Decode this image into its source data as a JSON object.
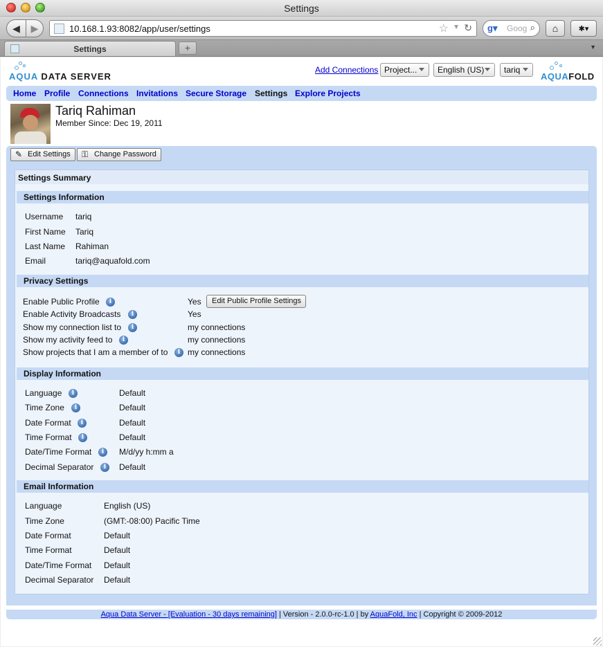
{
  "window": {
    "title": "Settings"
  },
  "browser": {
    "url": "10.168.1.93:8082/app/user/settings",
    "search_placeholder": "Google",
    "tab_label": "Settings",
    "new_tab_label": "+"
  },
  "header": {
    "logo_left_aqua": "AQUA",
    "logo_left_rest": " DATA SERVER",
    "logo_right_aqua": "AQUA",
    "logo_right_rest": "FOLD",
    "add_connections": "Add Connections",
    "project_select": "Project...",
    "language_select": "English (US)",
    "user_select": "tariq"
  },
  "menu": {
    "items": [
      {
        "label": "Home"
      },
      {
        "label": "Profile"
      },
      {
        "label": "Connections"
      },
      {
        "label": "Invitations"
      },
      {
        "label": "Secure Storage"
      },
      {
        "label": "Settings"
      },
      {
        "label": "Explore Projects"
      }
    ]
  },
  "user": {
    "name": "Tariq Rahiman",
    "member_since": "Member Since: Dec 19, 2011"
  },
  "toolbar": {
    "edit_settings": "Edit Settings",
    "change_password": "Change Password"
  },
  "summary": {
    "title": "Settings Summary",
    "settings_info": {
      "header": "Settings Information",
      "rows": [
        {
          "label": "Username",
          "value": "tariq"
        },
        {
          "label": "First Name",
          "value": "Tariq"
        },
        {
          "label": "Last Name",
          "value": "Rahiman"
        },
        {
          "label": "Email",
          "value": "tariq@aquafold.com"
        }
      ]
    },
    "privacy": {
      "header": "Privacy Settings",
      "edit_button": "Edit Public Profile Settings",
      "rows": [
        {
          "label": "Enable Public Profile",
          "value": "Yes"
        },
        {
          "label": "Enable Activity Broadcasts",
          "value": "Yes"
        },
        {
          "label": "Show my connection list to",
          "value": "my connections"
        },
        {
          "label": "Show my activity feed to",
          "value": "my connections"
        },
        {
          "label": "Show projects that I am a member of to",
          "value": "my connections"
        }
      ]
    },
    "display": {
      "header": "Display Information",
      "rows": [
        {
          "label": "Language",
          "value": "Default"
        },
        {
          "label": "Time Zone",
          "value": "Default"
        },
        {
          "label": "Date Format",
          "value": "Default"
        },
        {
          "label": "Time Format",
          "value": "Default"
        },
        {
          "label": "Date/Time Format",
          "value": "M/d/yy h:mm a"
        },
        {
          "label": "Decimal Separator",
          "value": "Default"
        }
      ]
    },
    "email": {
      "header": "Email Information",
      "rows": [
        {
          "label": "Language",
          "value": "English (US)"
        },
        {
          "label": "Time Zone",
          "value": "(GMT:-08:00) Pacific Time"
        },
        {
          "label": "Date Format",
          "value": "Default"
        },
        {
          "label": "Time Format",
          "value": "Default"
        },
        {
          "label": "Date/Time Format",
          "value": "Default"
        },
        {
          "label": "Decimal Separator",
          "value": "Default"
        }
      ]
    }
  },
  "footer": {
    "product_link": "Aqua Data Server - [Evaluation - 30 days remaining]",
    "version_text": " | Version - 2.0.0-rc-1.0 | by ",
    "company_link": "AquaFold, Inc",
    "copyright": " | Copyright © 2009-2012"
  },
  "colors": {
    "accent_bar": "#c5d9f4",
    "link": "#0000cc",
    "panel_bg": "#eef4fc"
  }
}
